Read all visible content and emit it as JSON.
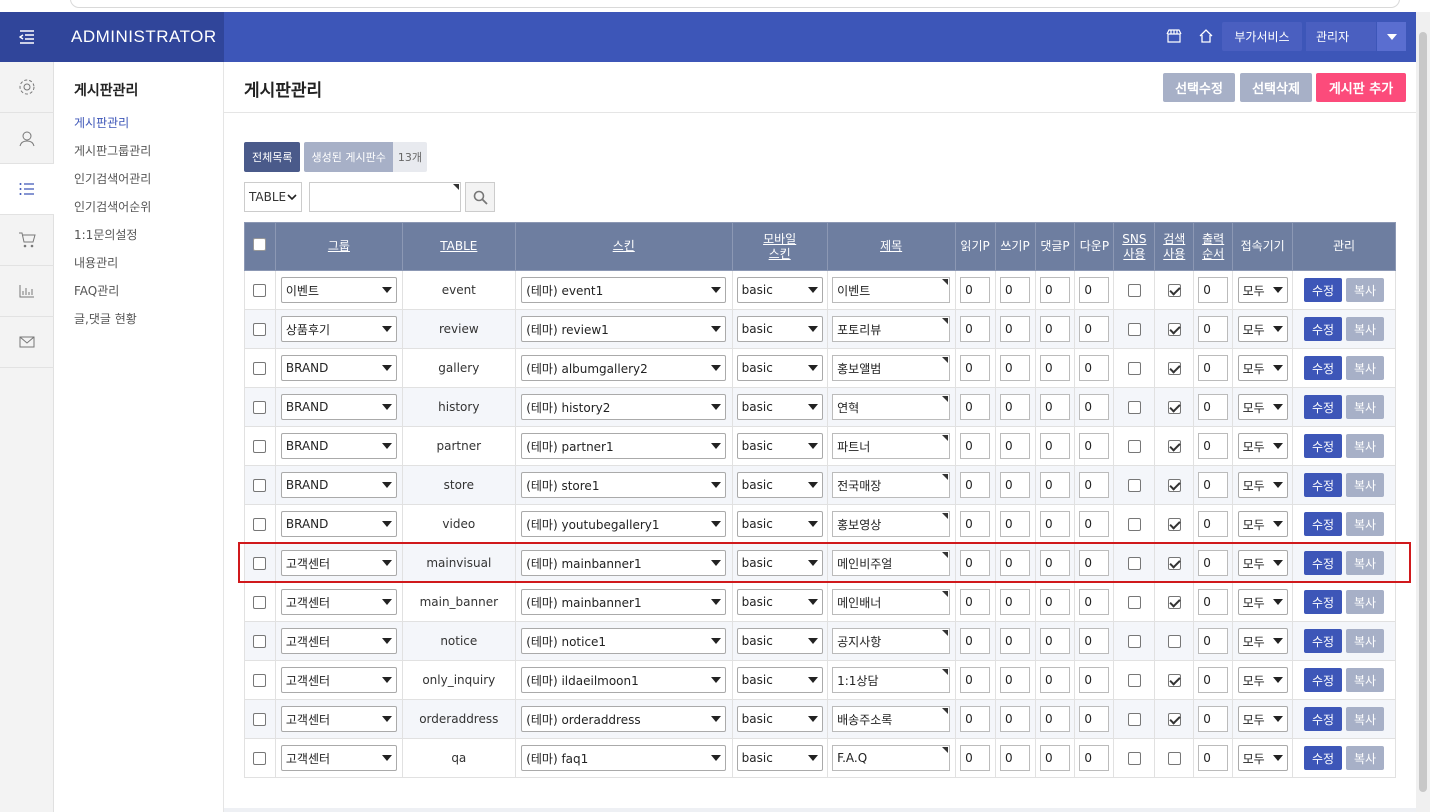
{
  "header": {
    "brand": "ADMINISTRATOR",
    "service_label": "부가서비스",
    "admin_label": "관리자"
  },
  "sidebar": {
    "title": "게시판관리",
    "items": [
      {
        "label": "게시판관리",
        "current": true
      },
      {
        "label": "게시판그룹관리"
      },
      {
        "label": "인기검색어관리"
      },
      {
        "label": "인기검색어순위"
      },
      {
        "label": "1:1문의설정"
      },
      {
        "label": "내용관리"
      },
      {
        "label": "FAQ관리"
      },
      {
        "label": "글,댓글 현황"
      }
    ]
  },
  "page": {
    "title": "게시판관리",
    "buttons": {
      "select_edit": "선택수정",
      "select_delete": "선택삭제",
      "add_board": "게시판 추가"
    },
    "tabs": {
      "all": "전체목록",
      "created_count_label": "생성된 게시판수",
      "created_count": "13개"
    },
    "search": {
      "field_value": "TABLE",
      "placeholder": ""
    }
  },
  "table": {
    "headers": {
      "group": "그룹",
      "table": "TABLE",
      "skin": "스킨",
      "mobile_skin": [
        "모바일",
        "스킨"
      ],
      "subject": "제목",
      "read_p": "읽기P",
      "write_p": "쓰기P",
      "comment_p": "댓글P",
      "download_p": "다운P",
      "sns": [
        "SNS",
        "사용"
      ],
      "search_use": [
        "검색",
        "사용"
      ],
      "order": [
        "출력",
        "순서"
      ],
      "device": "접속기기",
      "manage": "관리"
    },
    "edit_label": "수정",
    "copy_label": "복사",
    "rows": [
      {
        "group": "이벤트",
        "table": "event",
        "skin": "(테마) event1",
        "mobile": "basic",
        "subject": "이벤트",
        "read": "0",
        "write": "0",
        "comment": "0",
        "download": "0",
        "sns": false,
        "search": true,
        "order": "0",
        "device": "모두"
      },
      {
        "group": "상품후기",
        "table": "review",
        "skin": "(테마) review1",
        "mobile": "basic",
        "subject": "포토리뷰",
        "read": "0",
        "write": "0",
        "comment": "0",
        "download": "0",
        "sns": false,
        "search": true,
        "order": "0",
        "device": "모두"
      },
      {
        "group": "BRAND",
        "table": "gallery",
        "skin": "(테마) albumgallery2",
        "mobile": "basic",
        "subject": "홍보앨범",
        "read": "0",
        "write": "0",
        "comment": "0",
        "download": "0",
        "sns": false,
        "search": true,
        "order": "0",
        "device": "모두"
      },
      {
        "group": "BRAND",
        "table": "history",
        "skin": "(테마) history2",
        "mobile": "basic",
        "subject": "연혁",
        "read": "0",
        "write": "0",
        "comment": "0",
        "download": "0",
        "sns": false,
        "search": true,
        "order": "0",
        "device": "모두"
      },
      {
        "group": "BRAND",
        "table": "partner",
        "skin": "(테마) partner1",
        "mobile": "basic",
        "subject": "파트너",
        "read": "0",
        "write": "0",
        "comment": "0",
        "download": "0",
        "sns": false,
        "search": true,
        "order": "0",
        "device": "모두"
      },
      {
        "group": "BRAND",
        "table": "store",
        "skin": "(테마) store1",
        "mobile": "basic",
        "subject": "전국매장",
        "read": "0",
        "write": "0",
        "comment": "0",
        "download": "0",
        "sns": false,
        "search": true,
        "order": "0",
        "device": "모두"
      },
      {
        "group": "BRAND",
        "table": "video",
        "skin": "(테마) youtubegallery1",
        "mobile": "basic",
        "subject": "홍보영상",
        "read": "0",
        "write": "0",
        "comment": "0",
        "download": "0",
        "sns": false,
        "search": true,
        "order": "0",
        "device": "모두"
      },
      {
        "group": "고객센터",
        "table": "mainvisual",
        "skin": "(테마) mainbanner1",
        "mobile": "basic",
        "subject": "메인비주얼",
        "read": "0",
        "write": "0",
        "comment": "0",
        "download": "0",
        "sns": false,
        "search": true,
        "order": "0",
        "device": "모두"
      },
      {
        "group": "고객센터",
        "table": "main_banner",
        "skin": "(테마) mainbanner1",
        "mobile": "basic",
        "subject": "메인배너",
        "read": "0",
        "write": "0",
        "comment": "0",
        "download": "0",
        "sns": false,
        "search": true,
        "order": "0",
        "device": "모두"
      },
      {
        "group": "고객센터",
        "table": "notice",
        "skin": "(테마) notice1",
        "mobile": "basic",
        "subject": "공지사항",
        "read": "0",
        "write": "0",
        "comment": "0",
        "download": "0",
        "sns": false,
        "search": false,
        "order": "0",
        "device": "모두"
      },
      {
        "group": "고객센터",
        "table": "only_inquiry",
        "skin": "(테마) ildaeilmoon1",
        "mobile": "basic",
        "subject": "1:1상담",
        "read": "0",
        "write": "0",
        "comment": "0",
        "download": "0",
        "sns": false,
        "search": true,
        "order": "0",
        "device": "모두"
      },
      {
        "group": "고객센터",
        "table": "orderaddress",
        "skin": "(테마) orderaddress",
        "mobile": "basic",
        "subject": "배송주소록",
        "read": "0",
        "write": "0",
        "comment": "0",
        "download": "0",
        "sns": false,
        "search": true,
        "order": "0",
        "device": "모두"
      },
      {
        "group": "고객센터",
        "table": "qa",
        "skin": "(테마) faq1",
        "mobile": "basic",
        "subject": "F.A.Q",
        "read": "0",
        "write": "0",
        "comment": "0",
        "download": "0",
        "sns": false,
        "search": false,
        "order": "0",
        "device": "모두"
      }
    ]
  },
  "colors": {
    "topbar": "#3d56b8",
    "brand_bg": "#30459a",
    "header_row": "#6e7ea0",
    "primary_button": "#3d56b8",
    "add_button": "#fc4b7b",
    "secondary_button": "#a7b0c7",
    "highlight_box": "#d0191c"
  }
}
